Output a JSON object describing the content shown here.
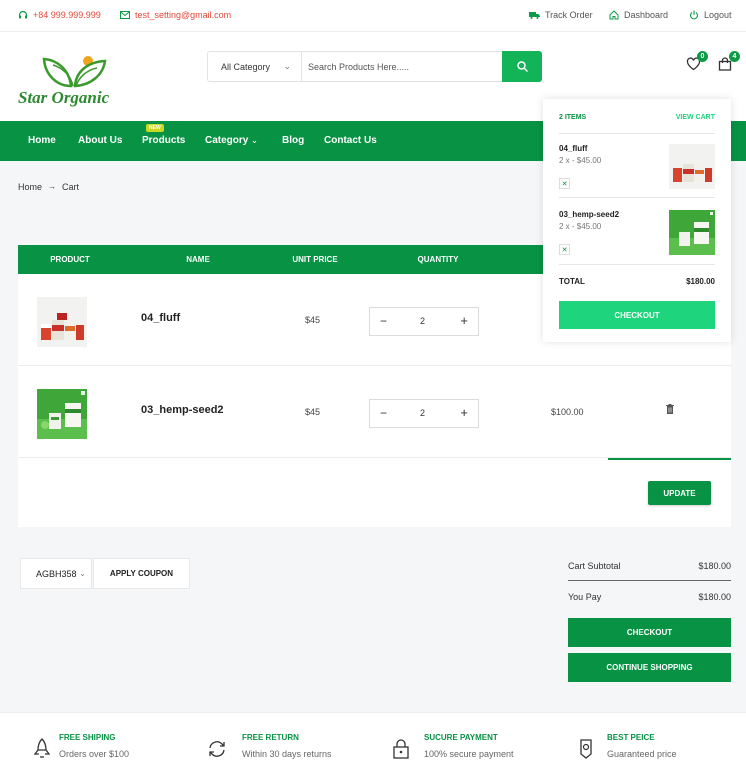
{
  "topbar": {
    "phone": "+84 999.999.999",
    "email": "test_setting@gmail.com",
    "track_order": "Track Order",
    "dashboard": "Dashboard",
    "logout": "Logout"
  },
  "header": {
    "logo_text": "Star Organic",
    "category_select": "All Category",
    "search_placeholder": "Search Products Here.....",
    "wishlist_count": "0",
    "cart_count": "4"
  },
  "nav": {
    "items": [
      "Home",
      "About Us",
      "Products",
      "Category",
      "Blog",
      "Contact Us"
    ],
    "new_badge": "NEW"
  },
  "breadcrumb": {
    "home": "Home",
    "separator": "→",
    "current": "Cart"
  },
  "cart_table": {
    "headers": [
      "PRODUCT",
      "NAME",
      "UNIT PRICE",
      "QUANTITY"
    ],
    "rows": [
      {
        "name": "04_fluff",
        "unit_price": "$45",
        "quantity": "2",
        "total": ""
      },
      {
        "name": "03_hemp-seed2",
        "unit_price": "$45",
        "quantity": "2",
        "total": "$100.00"
      }
    ],
    "update_label": "UPDATE"
  },
  "coupon": {
    "code": "AGBH358",
    "apply_label": "APPLY COUPON"
  },
  "totals": {
    "subtotal_label": "Cart Subtotal",
    "subtotal_value": "$180.00",
    "pay_label": "You Pay",
    "pay_value": "$180.00",
    "checkout_label": "CHECKOUT",
    "continue_label": "CONTINUE SHOPPING"
  },
  "mini_cart": {
    "items_count": "2 ITEMS",
    "view_cart": "VIEW CART",
    "items": [
      {
        "name": "04_fluff",
        "qty_price": "2 x - $45.00"
      },
      {
        "name": "03_hemp-seed2",
        "qty_price": "2 x - $45.00"
      }
    ],
    "total_label": "TOTAL",
    "total_value": "$180.00",
    "checkout_label": "CHECKOUT"
  },
  "features": [
    {
      "title": "FREE SHIPING",
      "subtitle": "Orders over $100"
    },
    {
      "title": "FREE RETURN",
      "subtitle": "Within 30 days returns"
    },
    {
      "title": "SUCURE PAYMENT",
      "subtitle": "100% secure payment"
    },
    {
      "title": "BEST PEICE",
      "subtitle": "Guaranteed price"
    }
  ],
  "colors": {
    "brand_green": "#079244",
    "accent_green": "#12b457",
    "light_green": "#1ed47c",
    "red": "#e04a3b"
  }
}
